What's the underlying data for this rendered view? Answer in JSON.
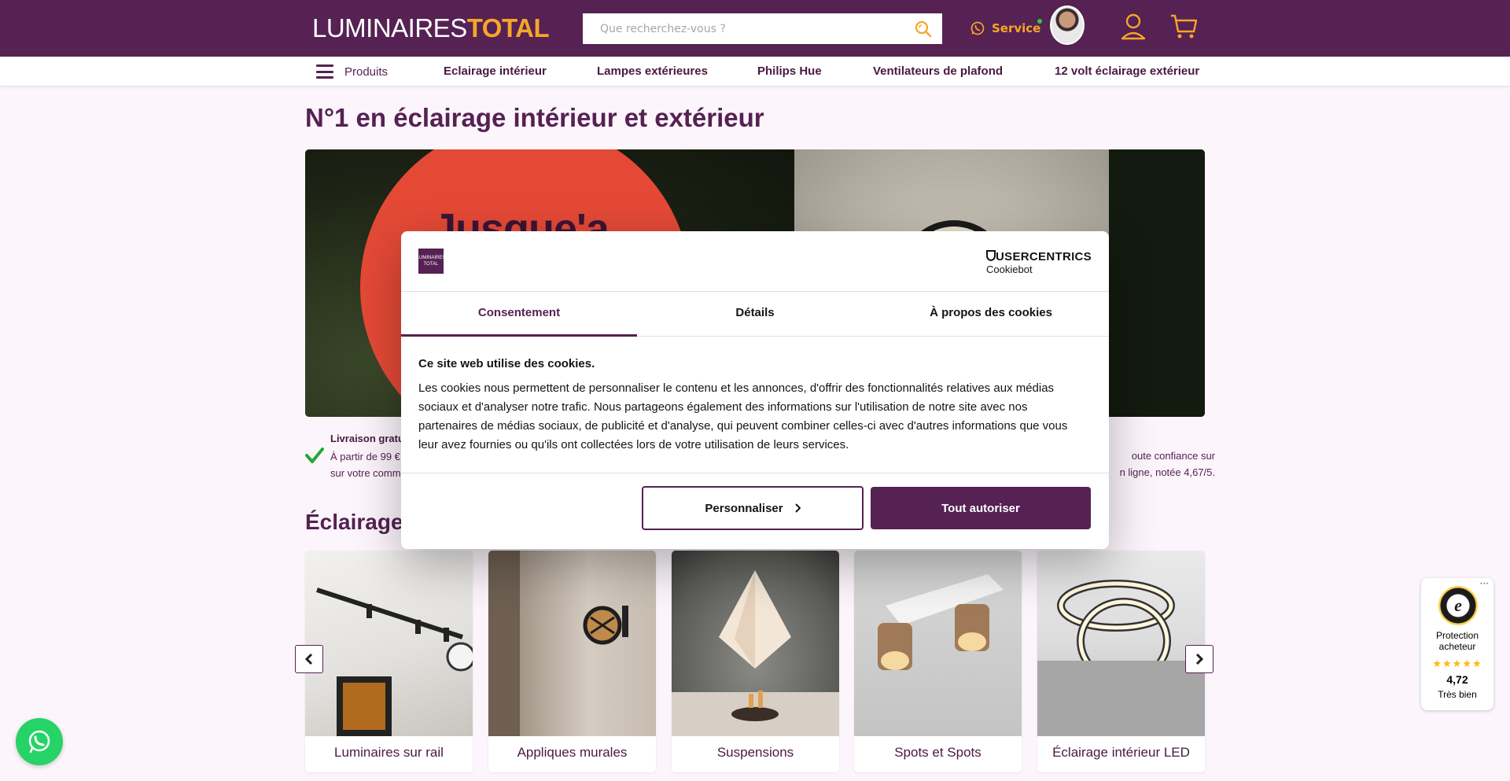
{
  "header": {
    "logo_part1": "LUMINAIRES",
    "logo_part2": "TOTAL",
    "search_placeholder": "Que recherchez-vous ?",
    "service_label": "Service",
    "brand_color": "#562153",
    "accent_color": "#f6a626"
  },
  "nav": {
    "products_label": "Produits",
    "links": [
      "Eclairage intérieur",
      "Lampes extérieures",
      "Philips Hue",
      "Ventilateurs de plafond",
      "12 volt éclairage extérieur"
    ]
  },
  "main": {
    "title": "N°1 en éclairage intérieur et extérieur",
    "hero_text": "Jusque'a",
    "usp_left_title": "Livraison gratu",
    "usp_left_line1": "À partir de 99 €",
    "usp_left_line2": "sur votre comm",
    "usp_right_line1": "oute confiance sur",
    "usp_right_line2": "n ligne, notée 4,67/5.",
    "section_title": "Éclairage i"
  },
  "categories": [
    {
      "label": "Luminaires sur rail"
    },
    {
      "label": "Appliques murales"
    },
    {
      "label": "Suspensions"
    },
    {
      "label": "Spots et Spots Encastrables"
    },
    {
      "label": "Éclairage intérieur LED"
    }
  ],
  "cookie_modal": {
    "logo_text": "LUMINAIRES TOTAL",
    "provider_line1": "USERCENTRICS",
    "provider_line2": "Cookiebot",
    "tabs": [
      "Consentement",
      "Détails",
      "À propos des cookies"
    ],
    "active_tab": 0,
    "heading": "Ce site web utilise des cookies.",
    "body": "Les cookies nous permettent de personnaliser le contenu et les annonces, d'offrir des fonctionnalités relatives aux médias sociaux et d'analyser notre trafic. Nous partageons également des informations sur l'utilisation de notre site avec nos partenaires de médias sociaux, de publicité et d'analyse, qui peuvent combiner celles-ci avec d'autres informations que vous leur avez fournies ou qu'ils ont collectées lors de votre utilisation de leurs services.",
    "customize_label": "Personnaliser",
    "allow_label": "Tout autoriser"
  },
  "trusted_shops": {
    "line1": "Protection",
    "line2": "acheteur",
    "stars": "★★★★★",
    "score": "4,72",
    "rating_text": "Très bien",
    "more": "···"
  },
  "icons": {
    "search": "search-icon",
    "whatsapp": "whatsapp-icon",
    "user": "user-icon",
    "cart": "cart-icon",
    "menu": "hamburger-icon",
    "check": "check-icon",
    "prev": "chevron-left-icon",
    "next": "chevron-right-icon"
  }
}
